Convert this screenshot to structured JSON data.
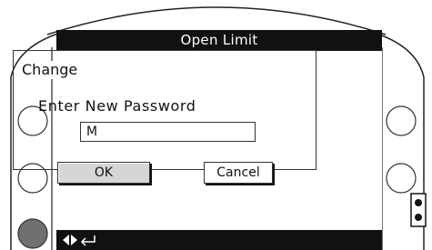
{
  "screen": {
    "title": "Open Limit",
    "dialog": {
      "group_label": "Change",
      "prompt": "Enter New Password",
      "password_value": "M",
      "ok_label": "OK",
      "cancel_label": "Cancel"
    }
  },
  "footer": {
    "icons": [
      "left-right-arrows-icon",
      "enter-return-icon"
    ]
  },
  "hardware": {
    "left_buttons": [
      "left-button-top",
      "left-button-middle",
      "left-button-bottom-active"
    ],
    "right_buttons": [
      "right-button-top",
      "right-button-middle"
    ],
    "indicator": "status-indicator"
  },
  "colors": {
    "bar_background": "#111111",
    "bar_text": "#ffffff",
    "ok_button_fill": "#d6d6d6",
    "active_hardware_button": "#707070"
  }
}
